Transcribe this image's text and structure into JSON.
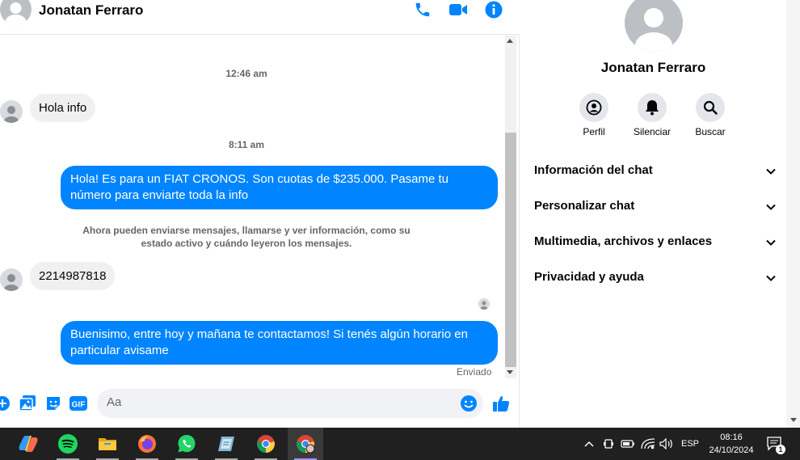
{
  "header": {
    "contact_name": "Jonatan Ferraro",
    "icons": [
      "phone-icon",
      "video-icon",
      "info-icon"
    ]
  },
  "messages": {
    "ts1": "12:46 am",
    "msg1": "Hola info",
    "ts2": "8:11 am",
    "msg2": "Hola! Es para un FIAT CRONOS. Son cuotas de $235.000. Pasame tu número para enviarte toda la info",
    "notice": "Ahora pueden enviarse mensajes, llamarse y ver información, como su estado activo y cuándo leyeron los mensajes.",
    "msg3": "2214987818",
    "msg4": "Buenisimo, entre hoy y mañana te contactamos! Si tenés algún horario en particular avisame",
    "status": "Enviado"
  },
  "composer": {
    "placeholder": "Aa"
  },
  "info": {
    "name": "Jonatan Ferraro",
    "actions": [
      {
        "label": "Perfil",
        "icon": "profile-icon"
      },
      {
        "label": "Silenciar",
        "icon": "bell-icon"
      },
      {
        "label": "Buscar",
        "icon": "search-icon"
      }
    ],
    "sections": [
      {
        "label": "Información del chat"
      },
      {
        "label": "Personalizar chat"
      },
      {
        "label": "Multimedia, archivos y enlaces"
      },
      {
        "label": "Privacidad y ayuda"
      }
    ]
  },
  "taskbar": {
    "language": "ESP",
    "time": "08:16",
    "date": "24/10/2024",
    "notification_count": "1"
  },
  "colors": {
    "accent": "#0084ff",
    "bubble_in": "#f0f0f0",
    "taskbar": "#202020"
  }
}
